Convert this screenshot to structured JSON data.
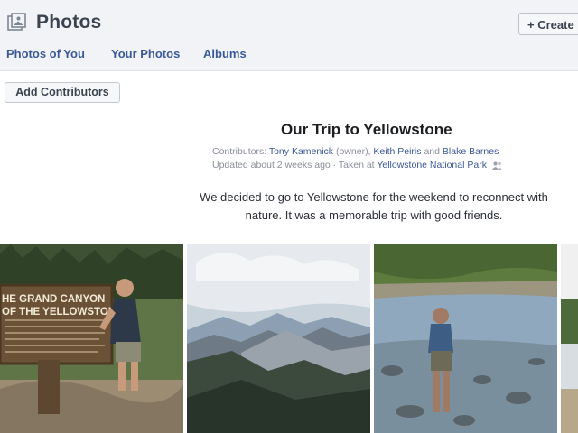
{
  "header": {
    "title": "Photos",
    "create_label": "+ Create",
    "tabs": [
      {
        "label": "Photos of You"
      },
      {
        "label": "Your Photos"
      },
      {
        "label": "Albums"
      }
    ]
  },
  "toolbar": {
    "add_contributors_label": "Add Contributors"
  },
  "album": {
    "title": "Our Trip to Yellowstone",
    "contributors_prefix": "Contributors:",
    "contributor_1": "Tony Kamenick",
    "owner_tag": "(owner),",
    "contributor_2": "Keith Peiris",
    "and_text": "and",
    "contributor_3": "Blake Barnes",
    "updated_text": "Updated about 2 weeks ago · Taken at",
    "location": "Yellowstone National Park",
    "description": "We decided to go to Yellowstone for the weekend to reconnect with nature. It was a memorable trip with good friends.",
    "sign_text": [
      "HE GRAND CANYON",
      "OF THE YELLOWSTONE"
    ]
  },
  "icons": {
    "app": "photos-icon",
    "audience": "people-icon"
  },
  "colors": {
    "link": "#3b5998",
    "header_bg": "#f1f3f7"
  }
}
